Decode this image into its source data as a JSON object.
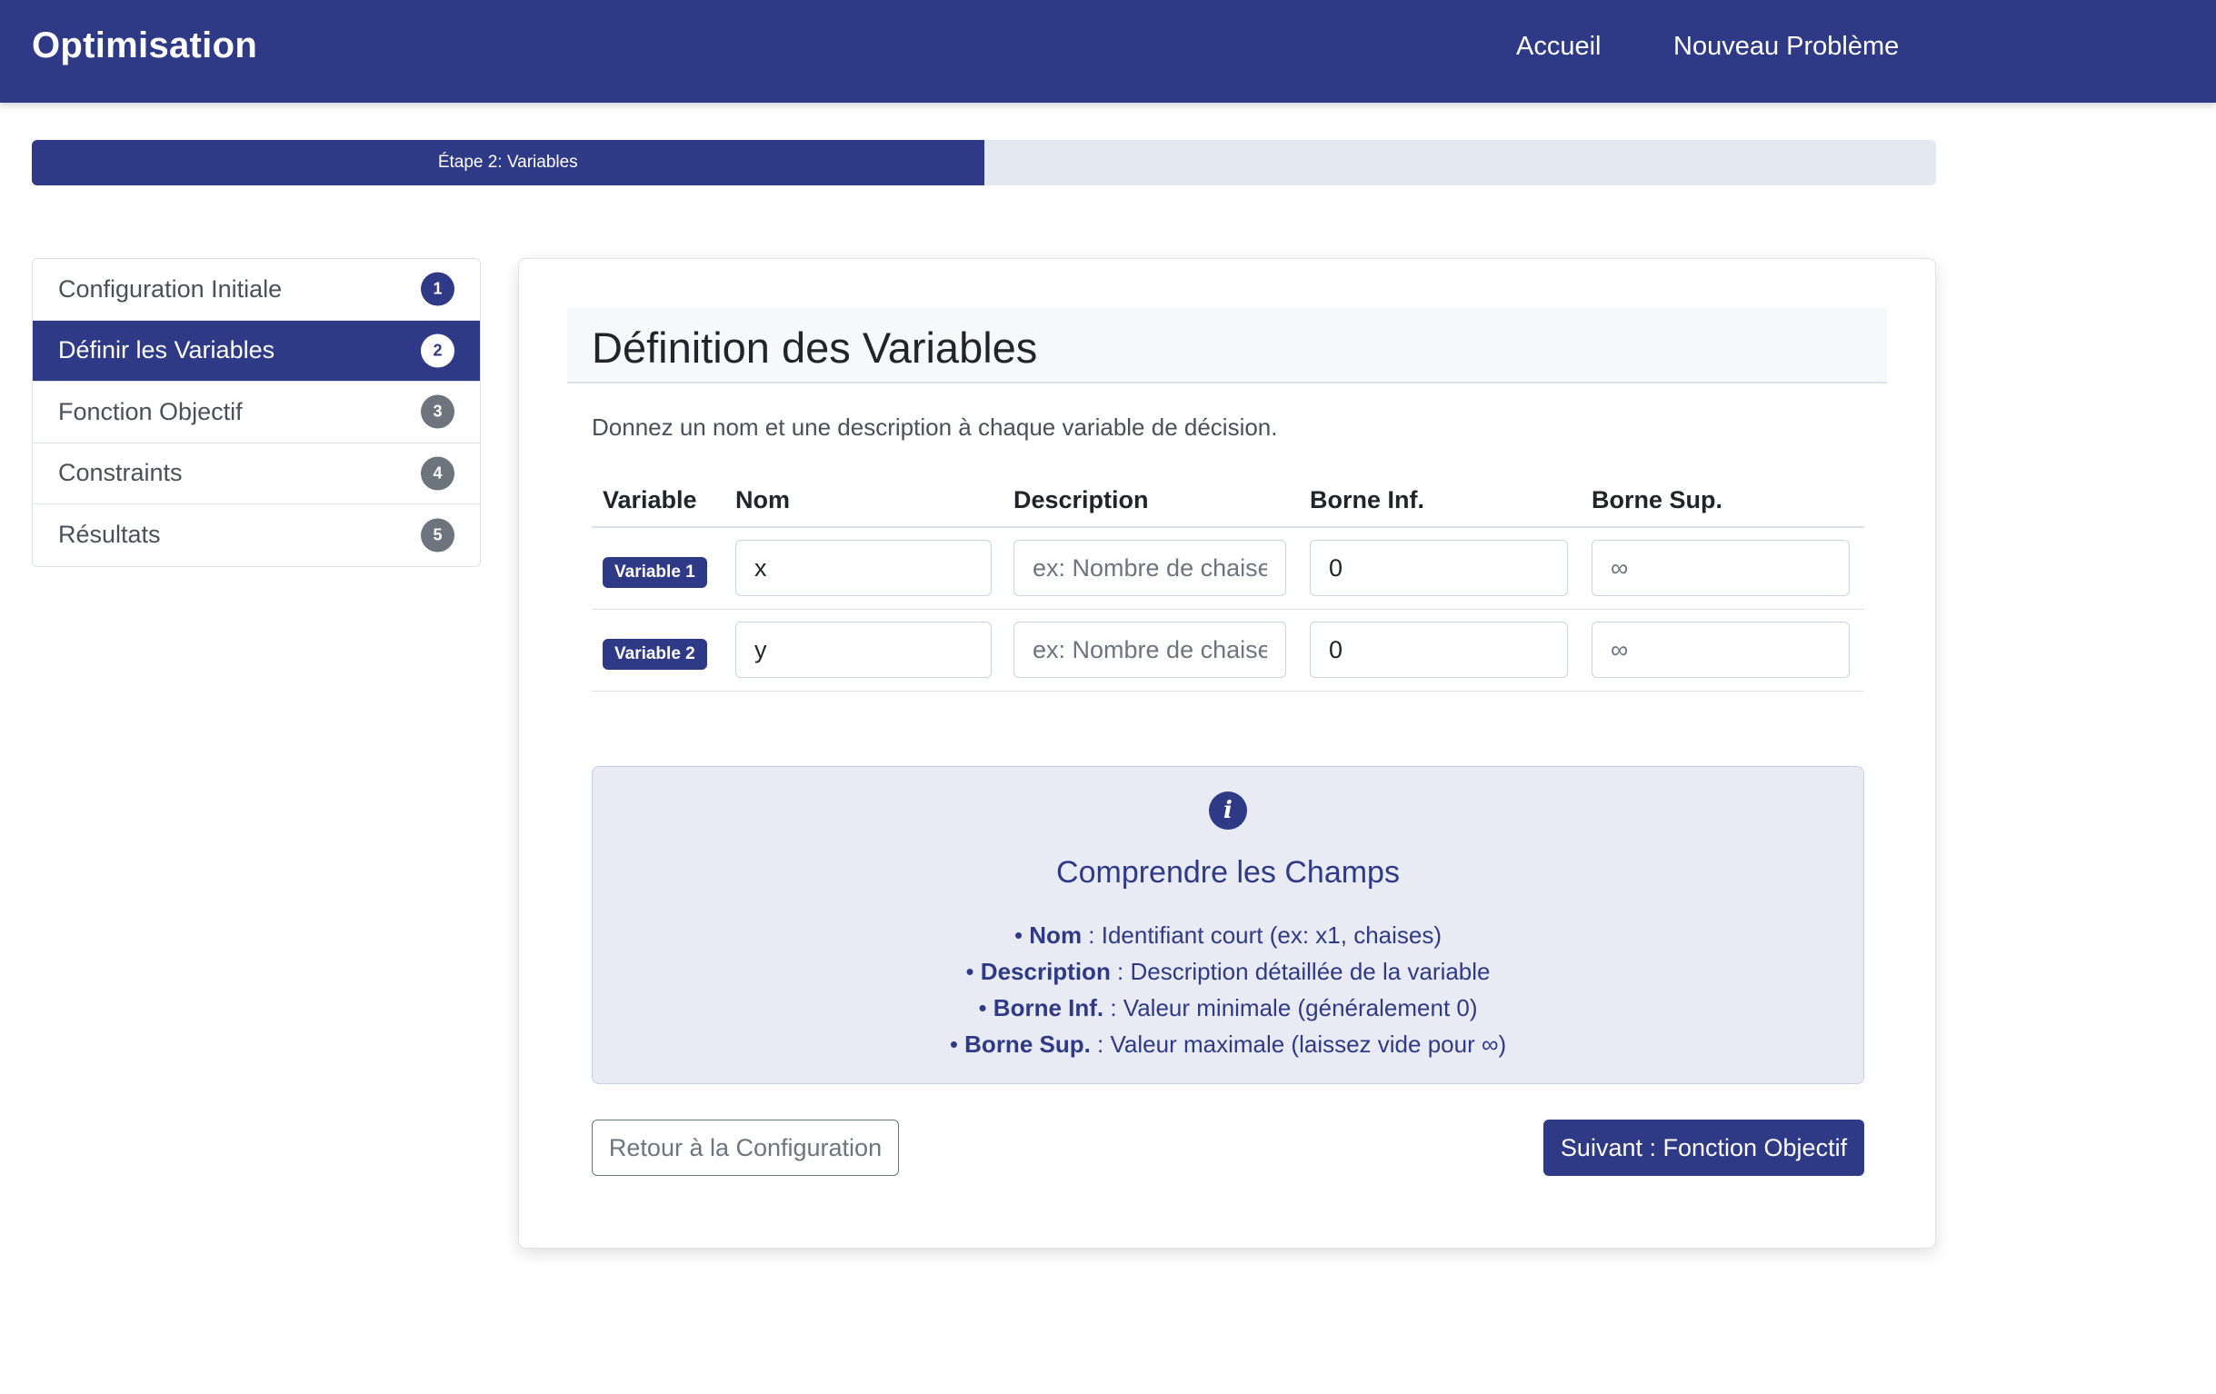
{
  "navbar": {
    "brand": "Optimisation",
    "links": [
      "Accueil",
      "Nouveau Problème"
    ]
  },
  "progress": {
    "label": "Étape 2: Variables",
    "fraction": 0.5
  },
  "sidebar": {
    "items": [
      {
        "label": "Configuration Initiale",
        "badge": "1"
      },
      {
        "label": "Définir les Variables",
        "badge": "2"
      },
      {
        "label": "Fonction Objectif",
        "badge": "3"
      },
      {
        "label": "Constraints",
        "badge": "4"
      },
      {
        "label": "Résultats",
        "badge": "5"
      }
    ]
  },
  "main": {
    "title": "Définition des Variables",
    "intro": "Donnez un nom et une description à chaque variable de décision.",
    "table": {
      "headers": [
        "Variable",
        "Nom",
        "Description",
        "Borne Inf.",
        "Borne Sup."
      ],
      "rows": [
        {
          "badge": "Variable 1",
          "nom": "x",
          "description_placeholder": "ex: Nombre de chaises",
          "borne_inf": "0",
          "borne_sup_placeholder": "∞"
        },
        {
          "badge": "Variable 2",
          "nom": "y",
          "description_placeholder": "ex: Nombre de chaises",
          "borne_inf": "0",
          "borne_sup_placeholder": "∞"
        }
      ]
    },
    "info": {
      "title": "Comprendre les Champs",
      "lines": [
        {
          "term": "Nom",
          "text": " : Identifiant court (ex: x1, chaises)"
        },
        {
          "term": "Description",
          "text": " : Description détaillée de la variable"
        },
        {
          "term": "Borne Inf.",
          "text": " : Valeur minimale (généralement 0)"
        },
        {
          "term": "Borne Sup.",
          "text": " : Valeur maximale (laissez vide pour ∞)"
        }
      ]
    },
    "buttons": {
      "back": "Retour à la Configuration",
      "next": "Suivant : Fonction Objectif"
    }
  }
}
